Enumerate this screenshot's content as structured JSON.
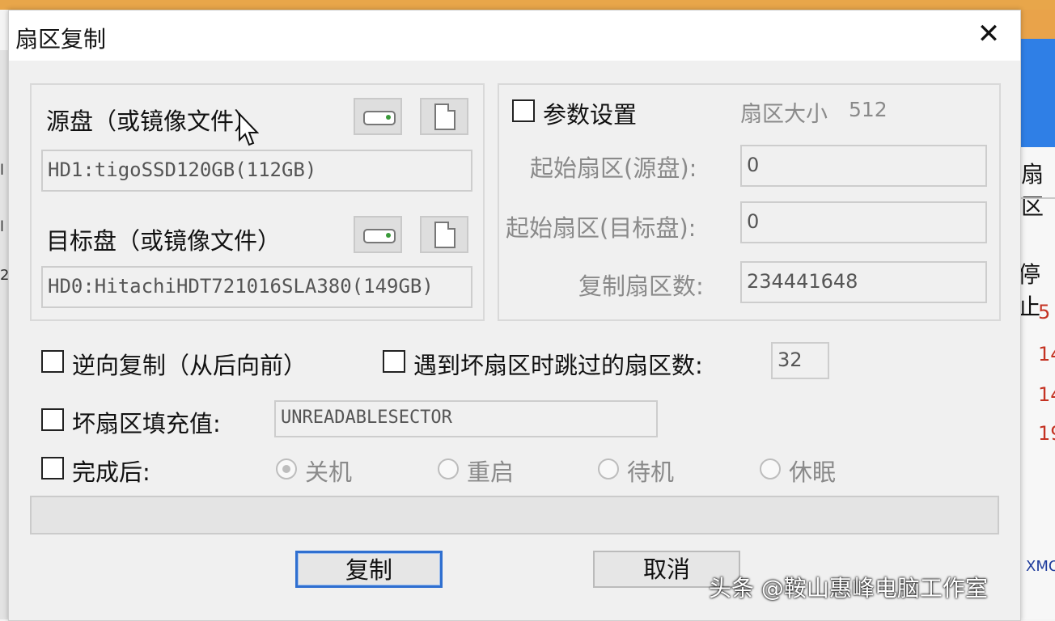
{
  "background": {
    "right_title": "扇区",
    "right_stop": "停止",
    "right_numbers": [
      "5",
      "14",
      "14",
      "19"
    ],
    "right_bottom": "XMO",
    "left_marks": [
      "l",
      "l",
      "2"
    ]
  },
  "dialog": {
    "title": "扇区复制",
    "close_glyph": "✕"
  },
  "source": {
    "label": "源盘（或镜像文件）",
    "value": "HD1:tigoSSD120GB(112GB)"
  },
  "target": {
    "label": "目标盘（或镜像文件）",
    "value": "HD0:HitachiHDT721016SLA380(149GB)"
  },
  "params": {
    "label": "参数设置",
    "sector_size_label": "扇区大小",
    "sector_size_value": "512",
    "start_src_label": "起始扇区(源盘):",
    "start_src_value": "0",
    "start_dst_label": "起始扇区(目标盘):",
    "start_dst_value": "0",
    "count_label": "复制扇区数:",
    "count_value": "234441648"
  },
  "options": {
    "reverse_label": "逆向复制（从后向前）",
    "skip_label": "遇到坏扇区时跳过的扇区数:",
    "skip_value": "32",
    "fill_label": "坏扇区填充值:",
    "fill_value": "UNREADABLESECTOR",
    "after_label": "完成后:",
    "after_options": [
      "关机",
      "重启",
      "待机",
      "休眠"
    ],
    "after_selected": "关机"
  },
  "buttons": {
    "copy": "复制",
    "cancel": "取消"
  },
  "watermark": "头条 @鞍山惠峰电脑工作室"
}
